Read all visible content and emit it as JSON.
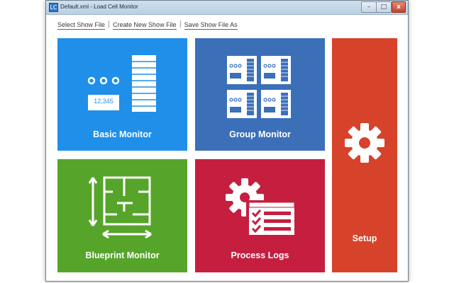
{
  "window": {
    "title": "Default.xml - Load Cell Monitor",
    "minimize_symbol": "–",
    "maximize_symbol": "□",
    "close_symbol": "x",
    "app_icon_text": "LC"
  },
  "menu": {
    "select_show_file": "Select Show File",
    "create_new_show_file": "Create New Show File",
    "save_show_file_as": "Save Show  File As"
  },
  "tiles": {
    "basic_monitor": {
      "label": "Basic Monitor",
      "display_value": "12,345",
      "color": "#1f8fea",
      "icon": "basic-monitor-icon"
    },
    "group_monitor": {
      "label": "Group Monitor",
      "color": "#3b70b9",
      "icon": "group-monitor-icon"
    },
    "setup": {
      "label": "Setup",
      "color": "#d6432a",
      "icon": "gear-icon"
    },
    "blueprint_monitor": {
      "label": "Blueprint Monitor",
      "color": "#56a52a",
      "icon": "blueprint-icon"
    },
    "process_logs": {
      "label": "Process Logs",
      "color": "#c61e3f",
      "icon": "process-logs-icon"
    }
  }
}
